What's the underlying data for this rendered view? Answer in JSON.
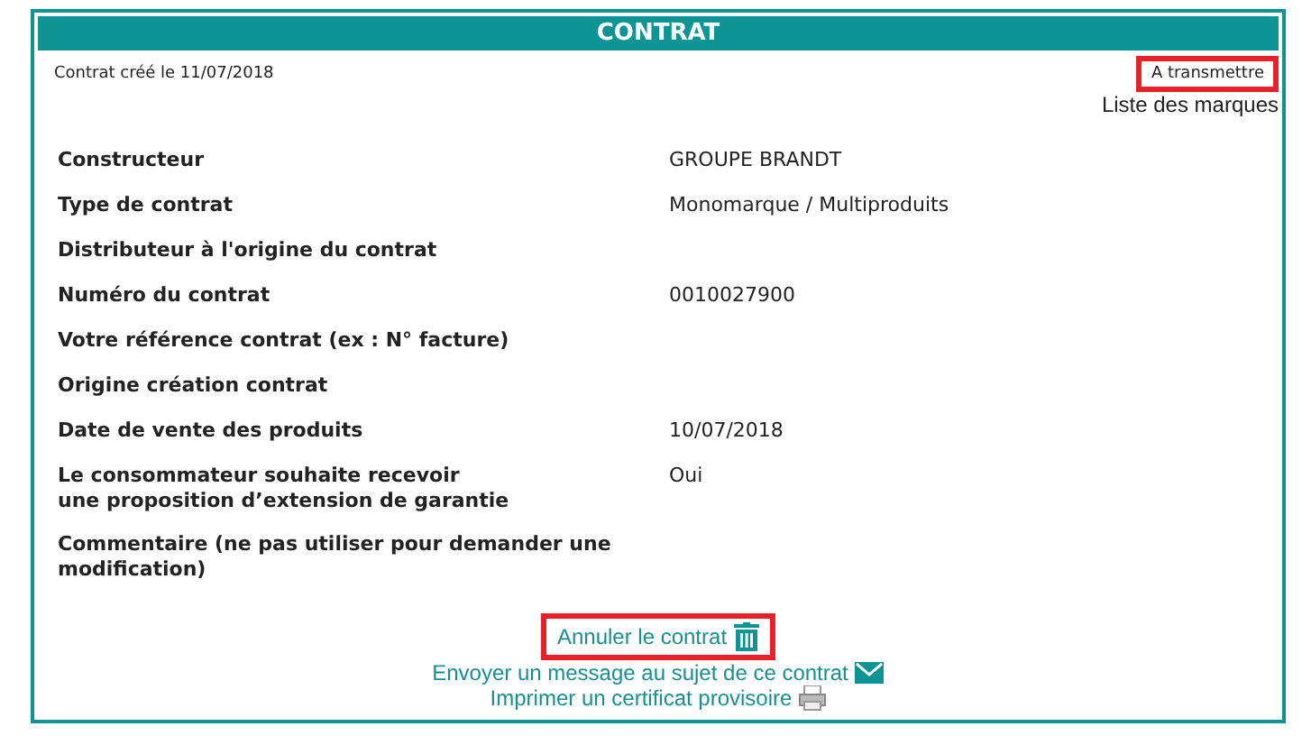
{
  "panel": {
    "title": "CONTRAT",
    "created": "Contrat créé le 11/07/2018",
    "status": {
      "label": "A transmettre",
      "highlighted": true
    },
    "brands_link": "Liste des marques"
  },
  "fields": [
    {
      "label": "Constructeur",
      "value": "GROUPE BRANDT"
    },
    {
      "label": "Type de contrat",
      "value": "Monomarque / Multiproduits"
    },
    {
      "label": "Distributeur à l'origine du contrat"
    },
    {
      "label": "Numéro du contrat",
      "value": "0010027900"
    },
    {
      "label": "Votre référence contrat (ex : N° facture)"
    },
    {
      "label": "Origine création contrat"
    },
    {
      "label": "Date de vente des produits",
      "value": "10/07/2018"
    },
    {
      "label": "Le consommateur souhaite recevoir\nune proposition d’extension de garantie",
      "value": "Oui"
    },
    {
      "label": "Commentaire (ne pas utiliser pour demander une\nmodification)"
    }
  ],
  "actions": [
    {
      "label": "Annuler le contrat",
      "kind": "delete",
      "highlighted": true
    },
    {
      "label": "Envoyer un message au sujet de ce contrat",
      "kind": "message",
      "highlighted": false
    },
    {
      "label": "Imprimer un certificat provisoire",
      "kind": "print",
      "highlighted": false
    }
  ]
}
